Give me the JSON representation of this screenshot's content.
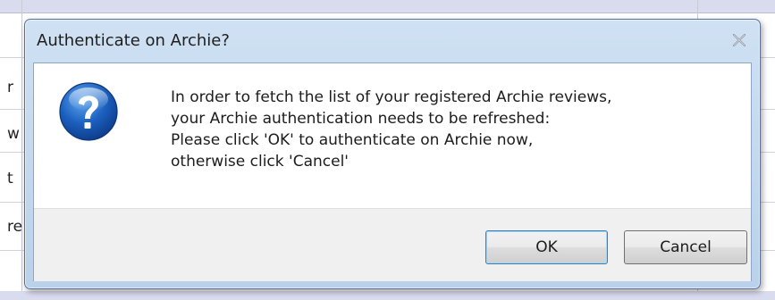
{
  "background": {
    "rows": [
      {
        "fragment": "r"
      },
      {
        "fragment": "w"
      },
      {
        "fragment": "t"
      },
      {
        "fragment": "re"
      }
    ]
  },
  "dialog": {
    "title": "Authenticate on Archie?",
    "close_icon": "close-icon",
    "message_icon": "question-icon",
    "message_lines": [
      "In order to fetch the list of your registered Archie reviews,",
      "your Archie authentication needs to be refreshed:",
      "Please click 'OK' to authenticate on Archie now,",
      "otherwise click 'Cancel'"
    ],
    "buttons": {
      "ok": "OK",
      "cancel": "Cancel"
    }
  },
  "colors": {
    "dialog_frame": "#b9d1ea",
    "ok_focus_border": "#3c7fb1",
    "icon_blue": "#1b5fbe"
  }
}
